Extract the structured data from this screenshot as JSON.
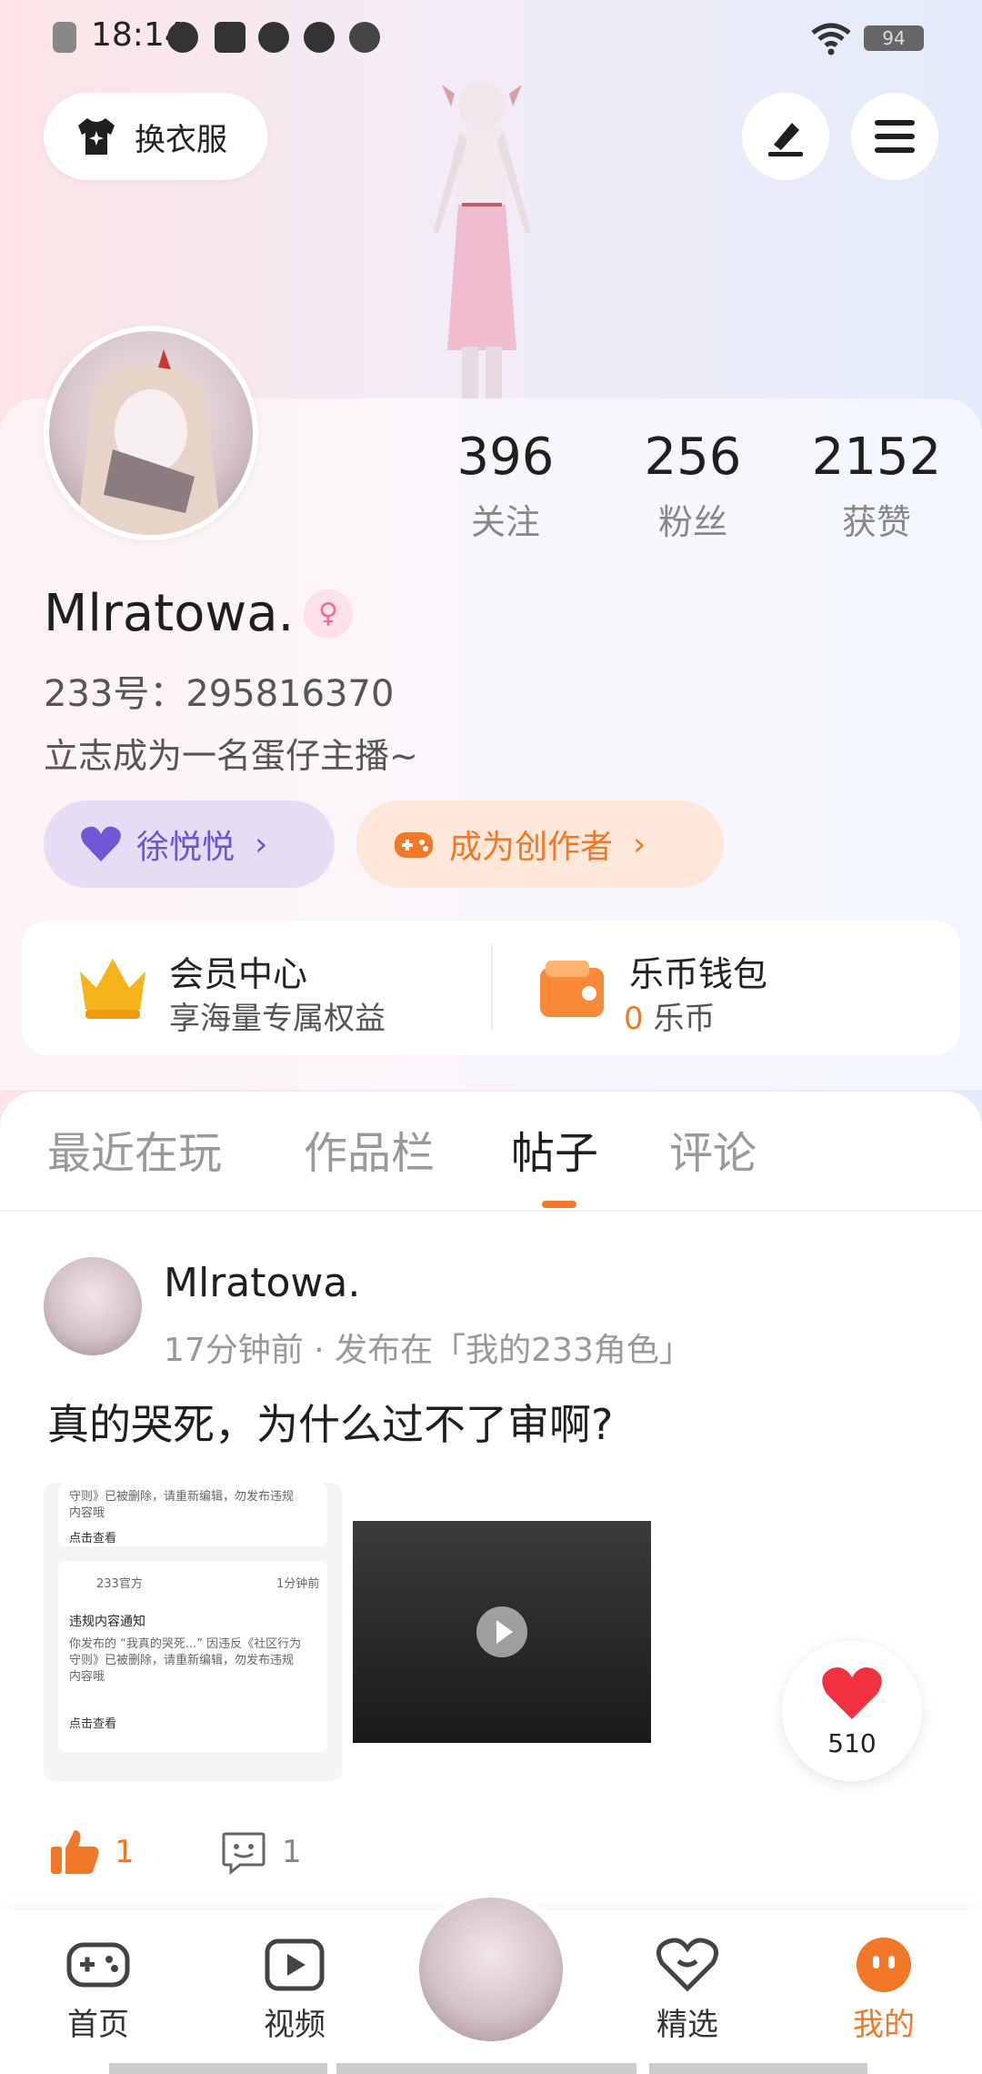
{
  "status_bar": {
    "time": "18:14",
    "battery": "94"
  },
  "header": {
    "outfit_label": "换衣服"
  },
  "profile": {
    "username": "Mlratowa.",
    "id_line": "233号：295816370",
    "bio": "立志成为一名蛋仔主播~",
    "stats": [
      {
        "value": "396",
        "label": "关注"
      },
      {
        "value": "256",
        "label": "粉丝"
      },
      {
        "value": "2152",
        "label": "获赞"
      }
    ],
    "fan_pill": "徐悦悦",
    "creator_pill": "成为创作者"
  },
  "benefits": {
    "member_title": "会员中心",
    "member_sub": "享海量专属权益",
    "wallet_title": "乐币钱包",
    "wallet_amount": "0",
    "wallet_unit": "乐币"
  },
  "tabs": [
    {
      "label": "最近在玩"
    },
    {
      "label": "作品栏"
    },
    {
      "label": "帖子"
    },
    {
      "label": "评论"
    }
  ],
  "post": {
    "author": "Mlratowa.",
    "meta": "17分钟前 · 发布在「我的233角色」",
    "title": "真的哭死，为什么过不了审啊?",
    "thumb1": {
      "line1": "守则》已被删除，请重新编辑，勿发布违规",
      "line2": "内容哦",
      "view": "点击查看",
      "official": "233官方",
      "time": "1分钟前",
      "notice_title": "违规内容通知",
      "notice_body1": "你发布的 “我真的哭死...” 因违反《社区行为",
      "notice_body2": "守则》已被删除，请重新编辑，勿发布违规",
      "notice_body3": "内容哦",
      "view2": "点击查看"
    },
    "likes": "1",
    "comments": "1"
  },
  "float_like": {
    "count": "510"
  },
  "nav": {
    "home": "首页",
    "video": "视频",
    "featured": "精选",
    "mine": "我的"
  },
  "colors": {
    "accent": "#f07828",
    "fan_pill": "#6d55cf"
  }
}
